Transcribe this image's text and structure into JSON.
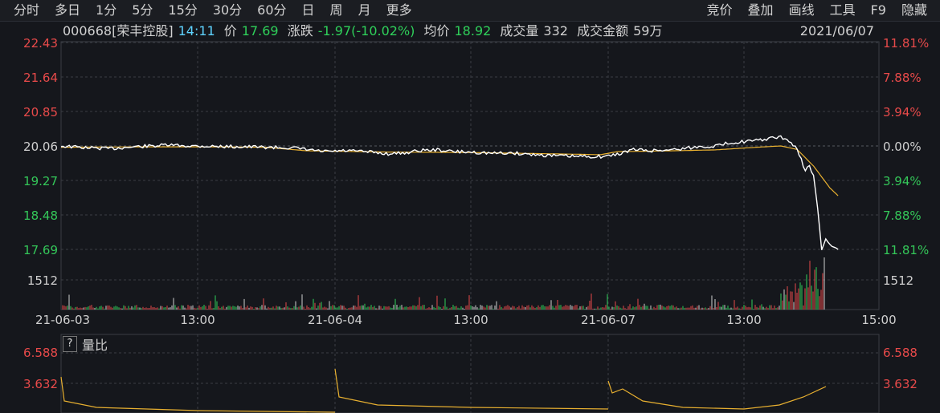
{
  "toolbar": {
    "left": [
      "分时",
      "多日",
      "1分",
      "5分",
      "15分",
      "30分",
      "60分",
      "日",
      "周",
      "月",
      "更多"
    ],
    "right": [
      "竞价",
      "叠加",
      "画线",
      "工具",
      "F9",
      "隐藏"
    ]
  },
  "stock": {
    "code_name": "000668[荣丰控股]",
    "time": "14:11",
    "price_label": "价",
    "price": "17.69",
    "change_label": "涨跌",
    "change": "-1.97(-10.02%)",
    "avg_label": "均价",
    "avg": "18.92",
    "volume_label": "成交量",
    "volume": "332",
    "amount_label": "成交金额",
    "amount": "59万",
    "date": "2021/06/07"
  },
  "axes": {
    "price_ticks": [
      "22.43",
      "21.64",
      "20.85",
      "20.06",
      "19.27",
      "18.48",
      "17.69"
    ],
    "pct_ticks": [
      "11.81%",
      "7.88%",
      "3.94%",
      "0.00%",
      "3.94%",
      "7.88%",
      "11.81%"
    ],
    "volume_tick": "1512",
    "x_ticks": [
      "21-06-03",
      "13:00",
      "21-06-04",
      "13:00",
      "21-06-07",
      "13:00",
      "15:00"
    ]
  },
  "sub_chart": {
    "help": "?",
    "title": "量比",
    "ticks": [
      "6.588",
      "3.632"
    ]
  },
  "colors": {
    "price_line": "#ffffff",
    "avg_line": "#e8b030",
    "up": "#e84a4a",
    "down": "#2fd05a",
    "grid": "#3a3d44"
  },
  "chart_data": {
    "type": "line",
    "x_sessions": [
      "21-06-03",
      "21-06-04",
      "21-06-07"
    ],
    "ylim": [
      17.69,
      22.43
    ],
    "pre_close": 20.06,
    "series": [
      {
        "price_points": [
          [
            0.0,
            20.06
          ],
          [
            0.03,
            20.02
          ],
          [
            0.06,
            20.0
          ],
          [
            0.09,
            20.04
          ],
          [
            0.13,
            20.08
          ],
          [
            0.16,
            20.06
          ],
          [
            0.19,
            20.05
          ],
          [
            0.23,
            20.04
          ],
          [
            0.25,
            20.03
          ],
          [
            0.28,
            20.02
          ],
          [
            0.3,
            19.98
          ],
          [
            0.32,
            19.93
          ],
          [
            0.35,
            19.95
          ],
          [
            0.38,
            19.92
          ],
          [
            0.4,
            19.88
          ],
          [
            0.42,
            19.9
          ],
          [
            0.44,
            19.96
          ],
          [
            0.46,
            19.97
          ],
          [
            0.48,
            19.93
          ],
          [
            0.5,
            19.92
          ],
          [
            0.53,
            19.89
          ],
          [
            0.55,
            19.9
          ],
          [
            0.58,
            19.86
          ],
          [
            0.6,
            19.84
          ],
          [
            0.63,
            19.82
          ],
          [
            0.66,
            19.82
          ],
          [
            0.67,
            19.83
          ],
          [
            0.68,
            19.87
          ],
          [
            0.7,
            19.98
          ],
          [
            0.72,
            19.95
          ],
          [
            0.75,
            19.98
          ],
          [
            0.78,
            20.04
          ],
          [
            0.8,
            20.06
          ],
          [
            0.82,
            20.14
          ],
          [
            0.85,
            20.18
          ],
          [
            0.87,
            20.24
          ],
          [
            0.88,
            20.26
          ],
          [
            0.89,
            20.18
          ],
          [
            0.9,
            19.98
          ],
          [
            0.91,
            19.5
          ],
          [
            0.915,
            19.6
          ],
          [
            0.92,
            19.4
          ],
          [
            0.925,
            18.6
          ],
          [
            0.93,
            17.69
          ],
          [
            0.935,
            17.9
          ],
          [
            0.94,
            17.8
          ],
          [
            0.945,
            17.75
          ],
          [
            0.95,
            17.69
          ]
        ]
      },
      {
        "avg_points": [
          [
            0.0,
            20.03
          ],
          [
            0.1,
            20.04
          ],
          [
            0.2,
            20.04
          ],
          [
            0.25,
            20.03
          ],
          [
            0.3,
            19.95
          ],
          [
            0.4,
            19.92
          ],
          [
            0.5,
            19.91
          ],
          [
            0.6,
            19.88
          ],
          [
            0.66,
            19.86
          ],
          [
            0.68,
            19.93
          ],
          [
            0.75,
            19.95
          ],
          [
            0.8,
            19.97
          ],
          [
            0.85,
            20.03
          ],
          [
            0.88,
            20.06
          ],
          [
            0.9,
            19.98
          ],
          [
            0.92,
            19.6
          ],
          [
            0.94,
            19.1
          ],
          [
            0.95,
            18.92
          ]
        ]
      }
    ],
    "volume_ratio_ticks": [
      6.588,
      3.632
    ]
  }
}
